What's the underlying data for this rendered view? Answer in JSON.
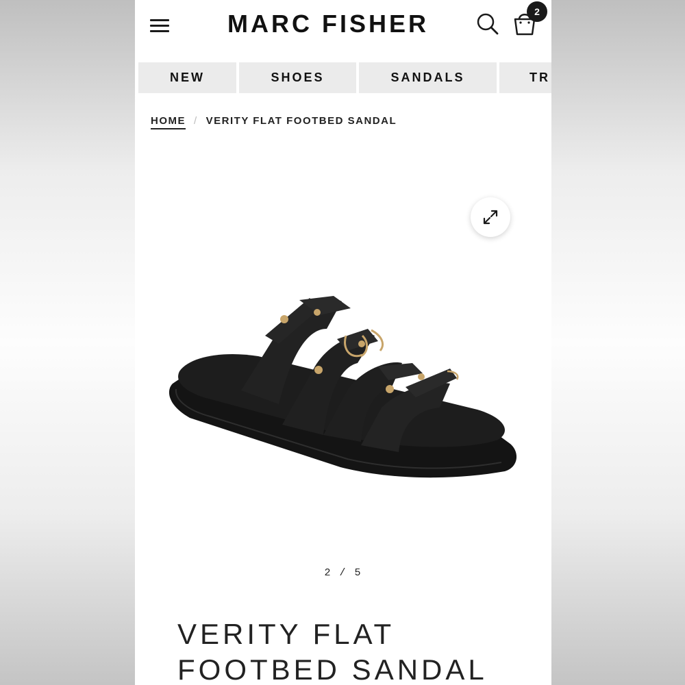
{
  "brand": "MARC FISHER",
  "cart": {
    "count": "2"
  },
  "nav": {
    "items": [
      {
        "label": "NEW"
      },
      {
        "label": "SHOES"
      },
      {
        "label": "SANDALS"
      },
      {
        "label": "TR"
      }
    ]
  },
  "breadcrumb": {
    "home": "HOME",
    "separator": "/",
    "current": "VERITY FLAT FOOTBED SANDAL"
  },
  "gallery": {
    "current": "2",
    "total": "5",
    "divider": "/"
  },
  "product": {
    "title_line1": "VERITY FLAT",
    "title_line2": "FOOTBED SANDAL"
  },
  "icons": {
    "menu": "hamburger-menu-icon",
    "search": "search-icon",
    "bag": "shopping-bag-icon",
    "expand": "expand-arrows-icon"
  },
  "colors": {
    "accent": "#1a1a1a",
    "nav_bg": "#ebebeb"
  }
}
